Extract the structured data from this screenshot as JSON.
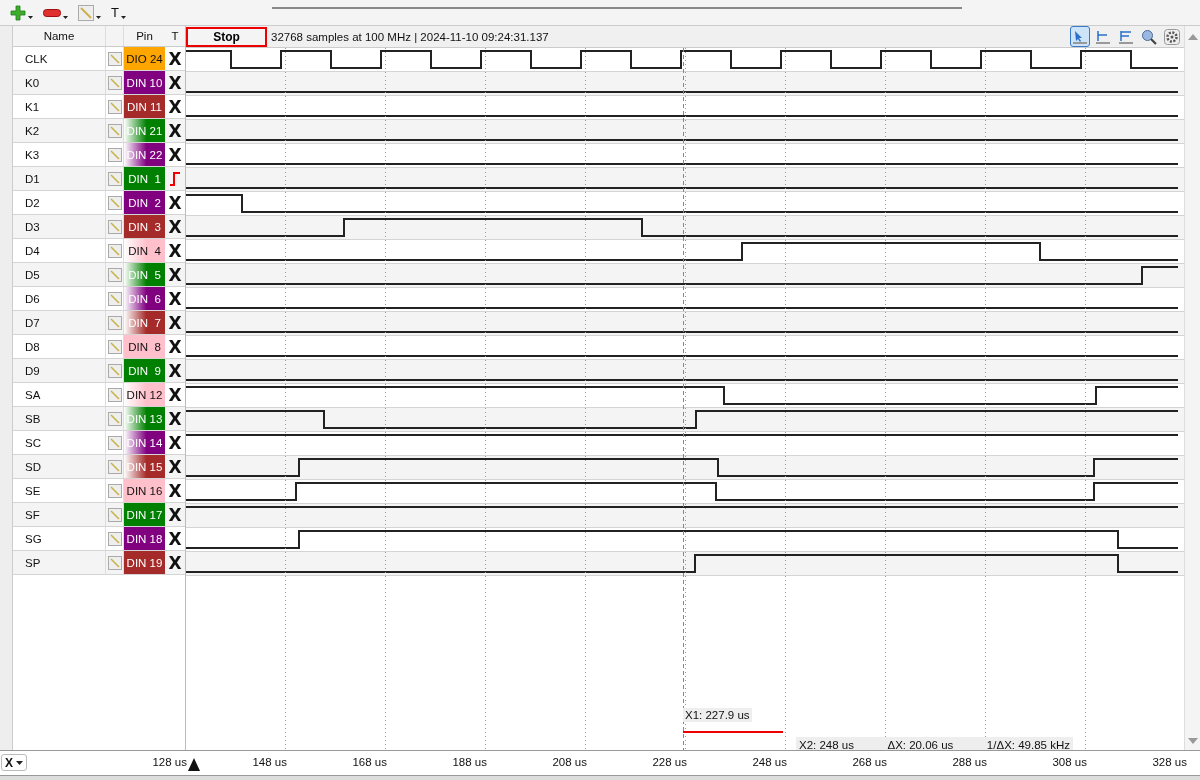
{
  "toolbar": {
    "text_tool": "T"
  },
  "header": {
    "name": "Name",
    "pin": "Pin",
    "trigger": "T"
  },
  "stop_button": "Stop",
  "capture_info": "32768 samples at 100 MHz | 2024-11-10 09:24:31.137",
  "view_tools": [
    {
      "kind": "pointer",
      "selected": true
    },
    {
      "kind": "cursor-one",
      "selected": false
    },
    {
      "kind": "cursor-two",
      "selected": false
    },
    {
      "kind": "zoom",
      "selected": false
    },
    {
      "kind": "settings",
      "selected": false
    }
  ],
  "channels": [
    {
      "name": "CLK",
      "pin": "DIO 24",
      "color": "#ffa500",
      "kind": "solid",
      "trigger": {
        "kind": "none",
        "mark": "X"
      }
    },
    {
      "name": "K0",
      "pin": "DIN 10",
      "color": "#800080",
      "kind": "solid",
      "trigger": {
        "kind": "none",
        "mark": "X"
      }
    },
    {
      "name": "K1",
      "pin": "DIN 11",
      "color": "#a52a2a",
      "kind": "solid",
      "trigger": {
        "kind": "none",
        "mark": "X"
      }
    },
    {
      "name": "K2",
      "pin": "DIN 21",
      "color": "#008000",
      "kind": "fade",
      "trigger": {
        "kind": "none",
        "mark": "X"
      }
    },
    {
      "name": "K3",
      "pin": "DIN 22",
      "color": "#800080",
      "kind": "fade",
      "trigger": {
        "kind": "none",
        "mark": "X"
      }
    },
    {
      "name": "D1",
      "pin": "DIN  1",
      "color": "#008000",
      "kind": "solid",
      "trigger": {
        "kind": "rising"
      }
    },
    {
      "name": "D2",
      "pin": "DIN  2",
      "color": "#800080",
      "kind": "solid",
      "trigger": {
        "kind": "none",
        "mark": "X"
      }
    },
    {
      "name": "D3",
      "pin": "DIN  3",
      "color": "#a52a2a",
      "kind": "solid",
      "trigger": {
        "kind": "none",
        "mark": "X"
      }
    },
    {
      "name": "D4",
      "pin": "DIN  4",
      "color": "#ffc0cb",
      "kind": "fade",
      "trigger": {
        "kind": "none",
        "mark": "X"
      }
    },
    {
      "name": "D5",
      "pin": "DIN  5",
      "color": "#008000",
      "kind": "fade",
      "trigger": {
        "kind": "none",
        "mark": "X"
      }
    },
    {
      "name": "D6",
      "pin": "DIN  6",
      "color": "#800080",
      "kind": "fade",
      "trigger": {
        "kind": "none",
        "mark": "X"
      }
    },
    {
      "name": "D7",
      "pin": "DIN  7",
      "color": "#a52a2a",
      "kind": "fade",
      "trigger": {
        "kind": "none",
        "mark": "X"
      }
    },
    {
      "name": "D8",
      "pin": "DIN  8",
      "color": "#ffc0cb",
      "kind": "solid",
      "trigger": {
        "kind": "none",
        "mark": "X"
      }
    },
    {
      "name": "D9",
      "pin": "DIN  9",
      "color": "#008000",
      "kind": "solid",
      "trigger": {
        "kind": "none",
        "mark": "X"
      }
    },
    {
      "name": "SA",
      "pin": "DIN 12",
      "color": "#ffc0cb",
      "kind": "fade",
      "trigger": {
        "kind": "none",
        "mark": "X"
      }
    },
    {
      "name": "SB",
      "pin": "DIN 13",
      "color": "#008000",
      "kind": "fade",
      "trigger": {
        "kind": "none",
        "mark": "X"
      }
    },
    {
      "name": "SC",
      "pin": "DIN 14",
      "color": "#800080",
      "kind": "fade",
      "trigger": {
        "kind": "none",
        "mark": "X"
      }
    },
    {
      "name": "SD",
      "pin": "DIN 15",
      "color": "#a52a2a",
      "kind": "fade",
      "trigger": {
        "kind": "none",
        "mark": "X"
      }
    },
    {
      "name": "SE",
      "pin": "DIN 16",
      "color": "#ffc0cb",
      "kind": "solid",
      "trigger": {
        "kind": "none",
        "mark": "X"
      }
    },
    {
      "name": "SF",
      "pin": "DIN 17",
      "color": "#008000",
      "kind": "solid",
      "trigger": {
        "kind": "none",
        "mark": "X"
      }
    },
    {
      "name": "SG",
      "pin": "DIN 18",
      "color": "#800080",
      "kind": "solid",
      "trigger": {
        "kind": "none",
        "mark": "X"
      }
    },
    {
      "name": "SP",
      "pin": "DIN 19",
      "color": "#a52a2a",
      "kind": "solid",
      "trigger": {
        "kind": "none",
        "mark": "X"
      }
    }
  ],
  "cursor_x1": {
    "label": "X1: 227.9 us"
  },
  "measurements": [
    "X2: 248 us",
    "ΔX: 20.06 us",
    "1/ΔX: 49.85 kHz"
  ],
  "time_axis": {
    "ticks": [
      "128 us",
      "148 us",
      "168 us",
      "188 us",
      "208 us",
      "228 us",
      "248 us",
      "268 us",
      "288 us",
      "308 us",
      "328 us"
    ]
  },
  "axis_selector": {
    "value": "X"
  }
}
